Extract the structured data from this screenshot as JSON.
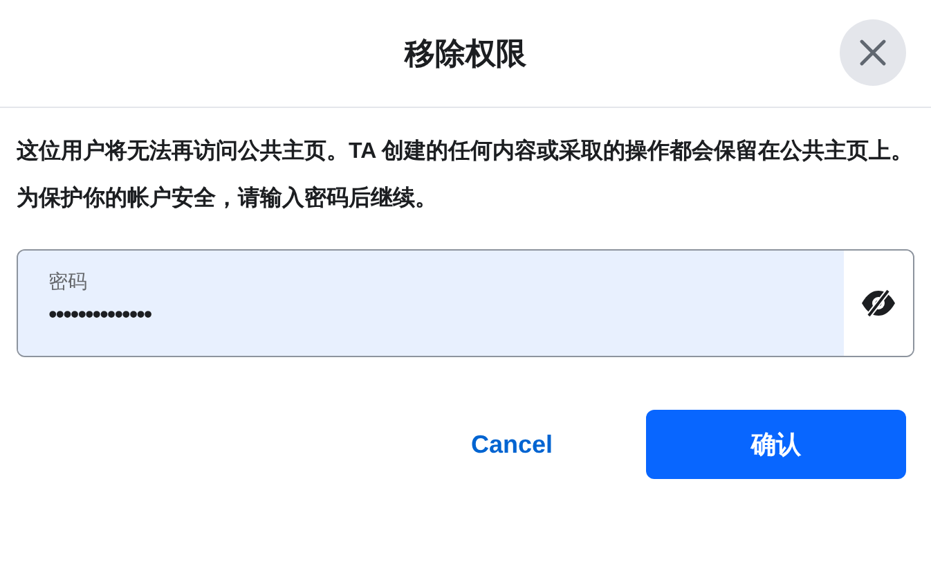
{
  "dialog": {
    "title": "移除权限"
  },
  "paragraphs": [
    "这位用户将无法再访问公共主页。TA 创建的任何内容或采取的操作都会保留在公共主页上。",
    "为保护你的帐户安全，请输入密码后继续。"
  ],
  "password_field": {
    "label": "密码",
    "value": "••••••••••••••",
    "revealed": false
  },
  "buttons": [
    {
      "label": "Cancel",
      "kind": "secondary"
    },
    {
      "label": "确认",
      "kind": "primary"
    }
  ]
}
